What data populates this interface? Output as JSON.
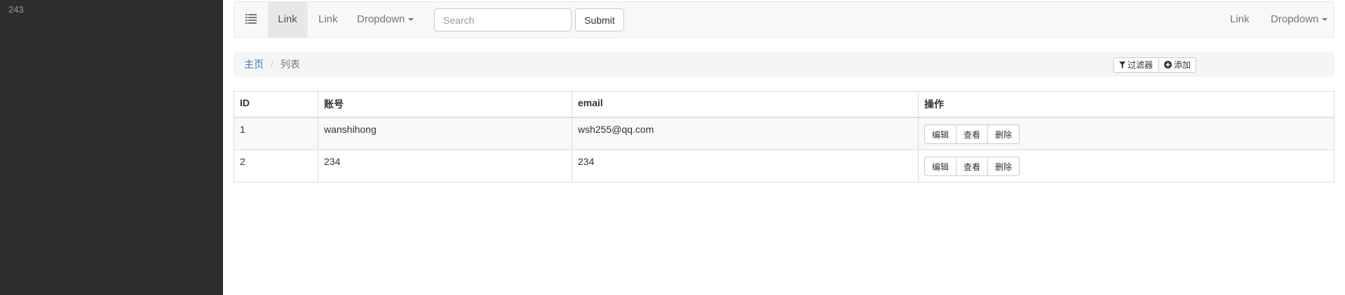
{
  "sidebar": {
    "text": "243"
  },
  "navbar": {
    "menu_icon": "list-icon",
    "link_1": "Link",
    "link_2": "Link",
    "dropdown_1": "Dropdown",
    "search_placeholder": "Search",
    "submit_label": "Submit",
    "link_right": "Link",
    "dropdown_right": "Dropdown"
  },
  "breadcrumb": {
    "home": "主页",
    "separator": "/",
    "current": "列表",
    "filter_label": "过滤器",
    "filter_icon": "filter-icon",
    "add_label": "添加",
    "add_icon": "plus-circle-icon"
  },
  "table": {
    "headers": [
      "ID",
      "账号",
      "email",
      "操作"
    ],
    "rows": [
      {
        "id": "1",
        "account": "wanshihong",
        "email": "wsh255@qq.com"
      },
      {
        "id": "2",
        "account": "234",
        "email": "234"
      }
    ],
    "actions": {
      "edit": "编辑",
      "view": "查看",
      "delete": "删除"
    }
  }
}
